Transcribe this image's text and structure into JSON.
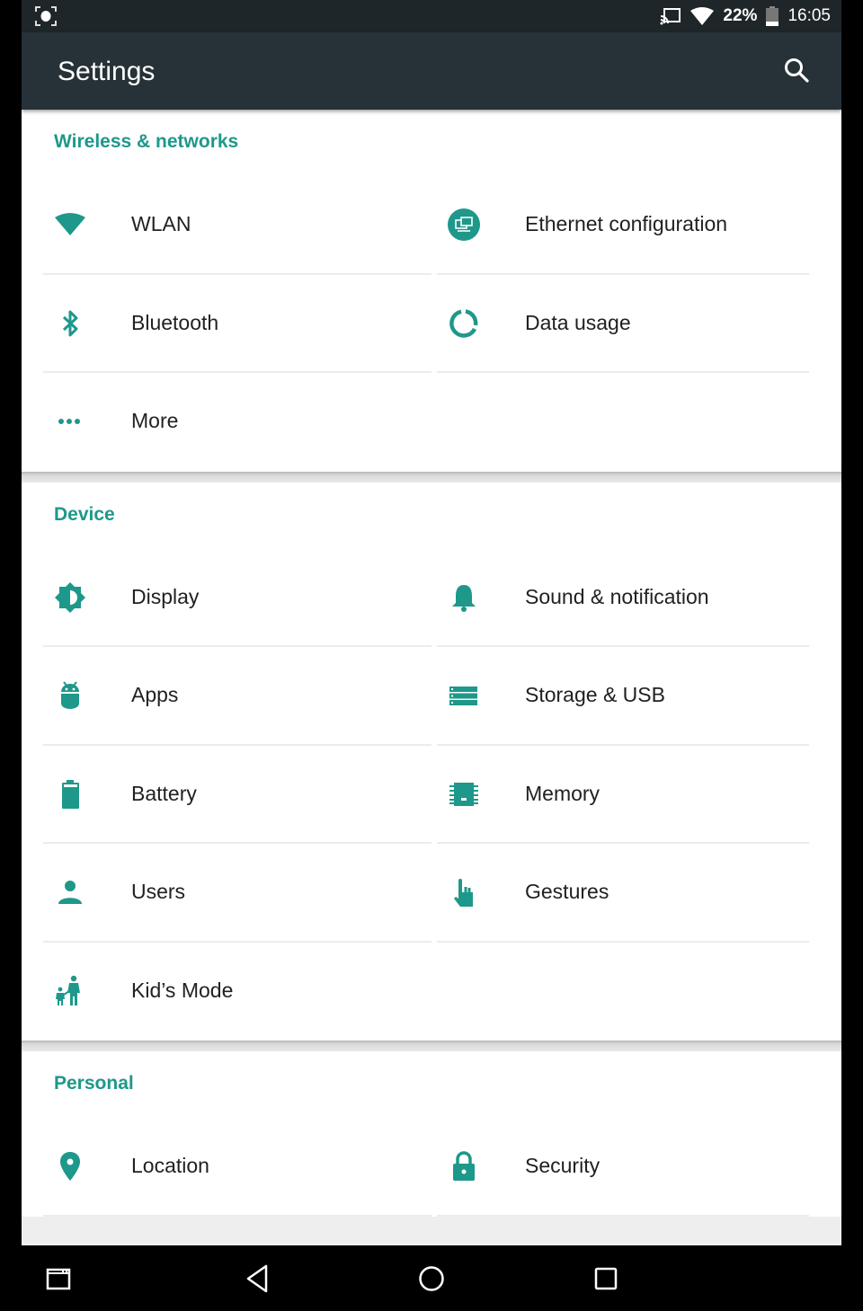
{
  "status_bar": {
    "battery_percent": "22%",
    "time": "16:05",
    "icons": [
      "screenshot-icon",
      "cast-icon",
      "wifi-icon",
      "battery-icon"
    ]
  },
  "app_bar": {
    "title": "Settings",
    "search_icon": "search-icon"
  },
  "accent_color": "#1e988a",
  "sections": [
    {
      "title": "Wireless & networks",
      "items": [
        {
          "label": "WLAN",
          "icon": "wifi-icon"
        },
        {
          "label": "Ethernet configuration",
          "icon": "ethernet-icon"
        },
        {
          "label": "Bluetooth",
          "icon": "bluetooth-icon"
        },
        {
          "label": "Data usage",
          "icon": "data-usage-icon"
        },
        {
          "label": "More",
          "icon": "more-dots-icon"
        }
      ]
    },
    {
      "title": "Device",
      "items": [
        {
          "label": "Display",
          "icon": "brightness-icon"
        },
        {
          "label": "Sound & notification",
          "icon": "bell-icon"
        },
        {
          "label": "Apps",
          "icon": "android-icon"
        },
        {
          "label": "Storage & USB",
          "icon": "storage-icon"
        },
        {
          "label": "Battery",
          "icon": "battery-icon"
        },
        {
          "label": "Memory",
          "icon": "memory-chip-icon"
        },
        {
          "label": "Users",
          "icon": "person-icon"
        },
        {
          "label": "Gestures",
          "icon": "hand-pointer-icon"
        },
        {
          "label": "Kid’s Mode",
          "icon": "parent-child-icon"
        }
      ]
    },
    {
      "title": "Personal",
      "items": [
        {
          "label": "Location",
          "icon": "location-pin-icon"
        },
        {
          "label": "Security",
          "icon": "lock-icon"
        }
      ]
    }
  ],
  "nav_bar": {
    "buttons": [
      "screenshot-window-icon",
      "back-icon",
      "home-icon",
      "recents-icon"
    ]
  }
}
